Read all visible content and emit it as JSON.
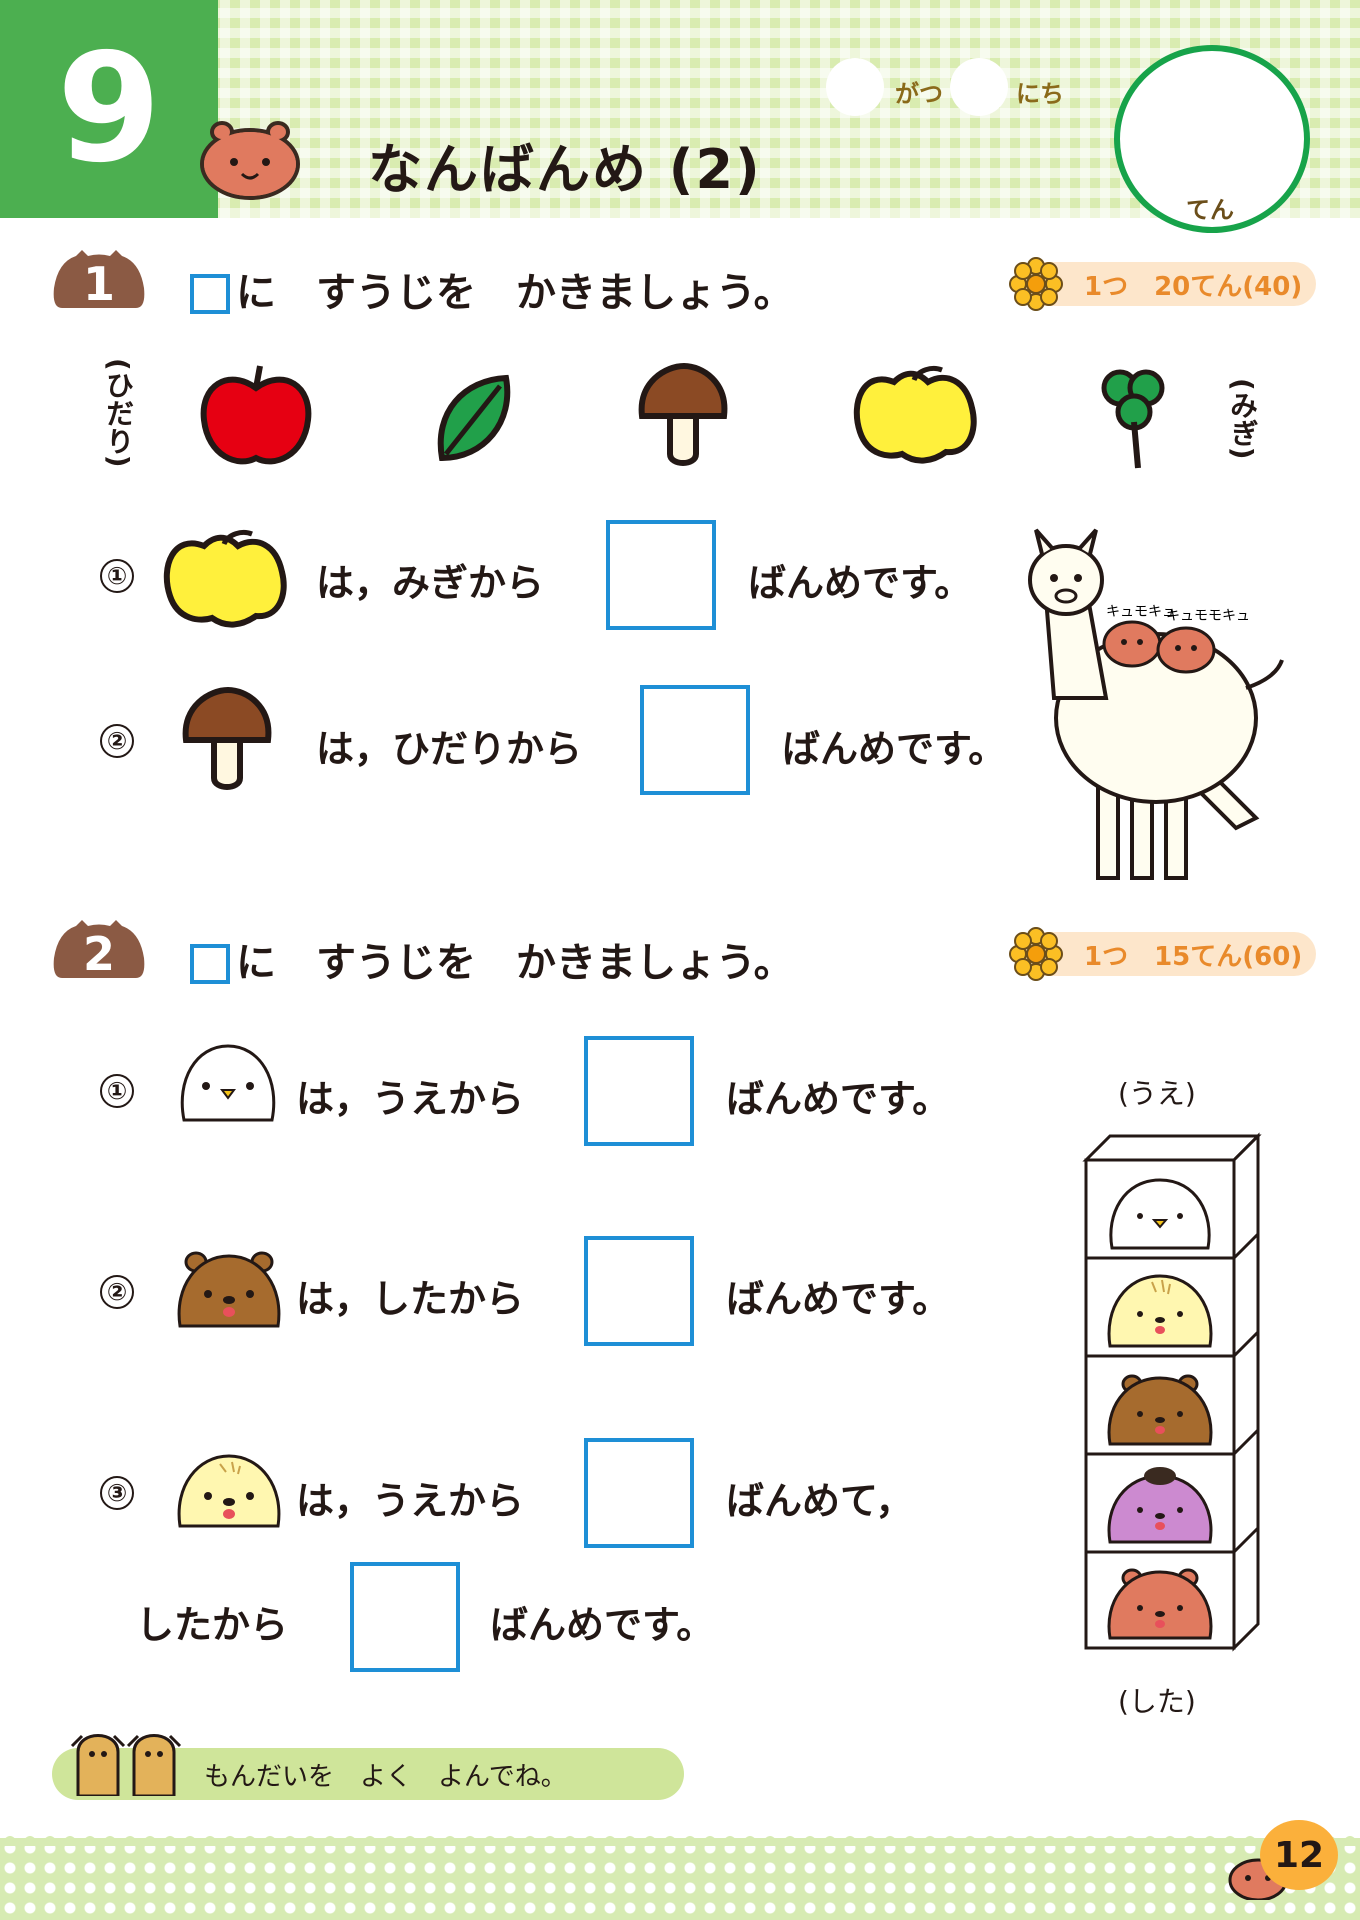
{
  "header": {
    "lesson_number": "9",
    "title": "なんばんめ (2)",
    "date_month_label": "がつ",
    "date_day_label": "にち",
    "score_label": "てん"
  },
  "section1": {
    "number": "1",
    "instruction": "に　すうじを　かきましょう。",
    "points": "1つ　20てん(40)",
    "left_label": "(ひだり)",
    "right_label": "(みぎ)",
    "row_items": [
      "apple-icon",
      "leaf-icon",
      "mushroom-icon",
      "yellow-apple-icon",
      "clover-icon"
    ],
    "questions": [
      {
        "num": "①",
        "text_before": "は，みぎから",
        "text_after": "ばんめです。"
      },
      {
        "num": "②",
        "text_before": "は，ひだりから",
        "text_after": "ばんめです。"
      }
    ],
    "alpaca_sound_1": "キュモキュ",
    "alpaca_sound_2": "キュモモキュ"
  },
  "section2": {
    "number": "2",
    "instruction": "に　すうじを　かきましょう。",
    "points": "1つ　15てん(60)",
    "top_label": "(うえ)",
    "bottom_label": "(した)",
    "stack_order": [
      "white-bird",
      "yellow-capybara",
      "brown-capybara",
      "purple-capybara",
      "red-capybara"
    ],
    "questions": [
      {
        "num": "①",
        "text_before": "は，うえから",
        "text_after": "ばんめです。"
      },
      {
        "num": "②",
        "text_before": "は，したから",
        "text_after": "ばんめです。"
      },
      {
        "num": "③",
        "text_before": "は，うえから",
        "text_after": "ばんめて，",
        "line2_before": "したから",
        "line2_after": "ばんめです。"
      }
    ]
  },
  "footer": {
    "hint": "もんだいを　よく　よんでね。",
    "page_number": "12"
  },
  "colors": {
    "header_green": "#4caf50",
    "answer_box_blue": "#1e8fd6",
    "score_circle_green": "#17a34a",
    "points_orange": "#e98a2b",
    "badge_brown": "#8b5a44"
  }
}
